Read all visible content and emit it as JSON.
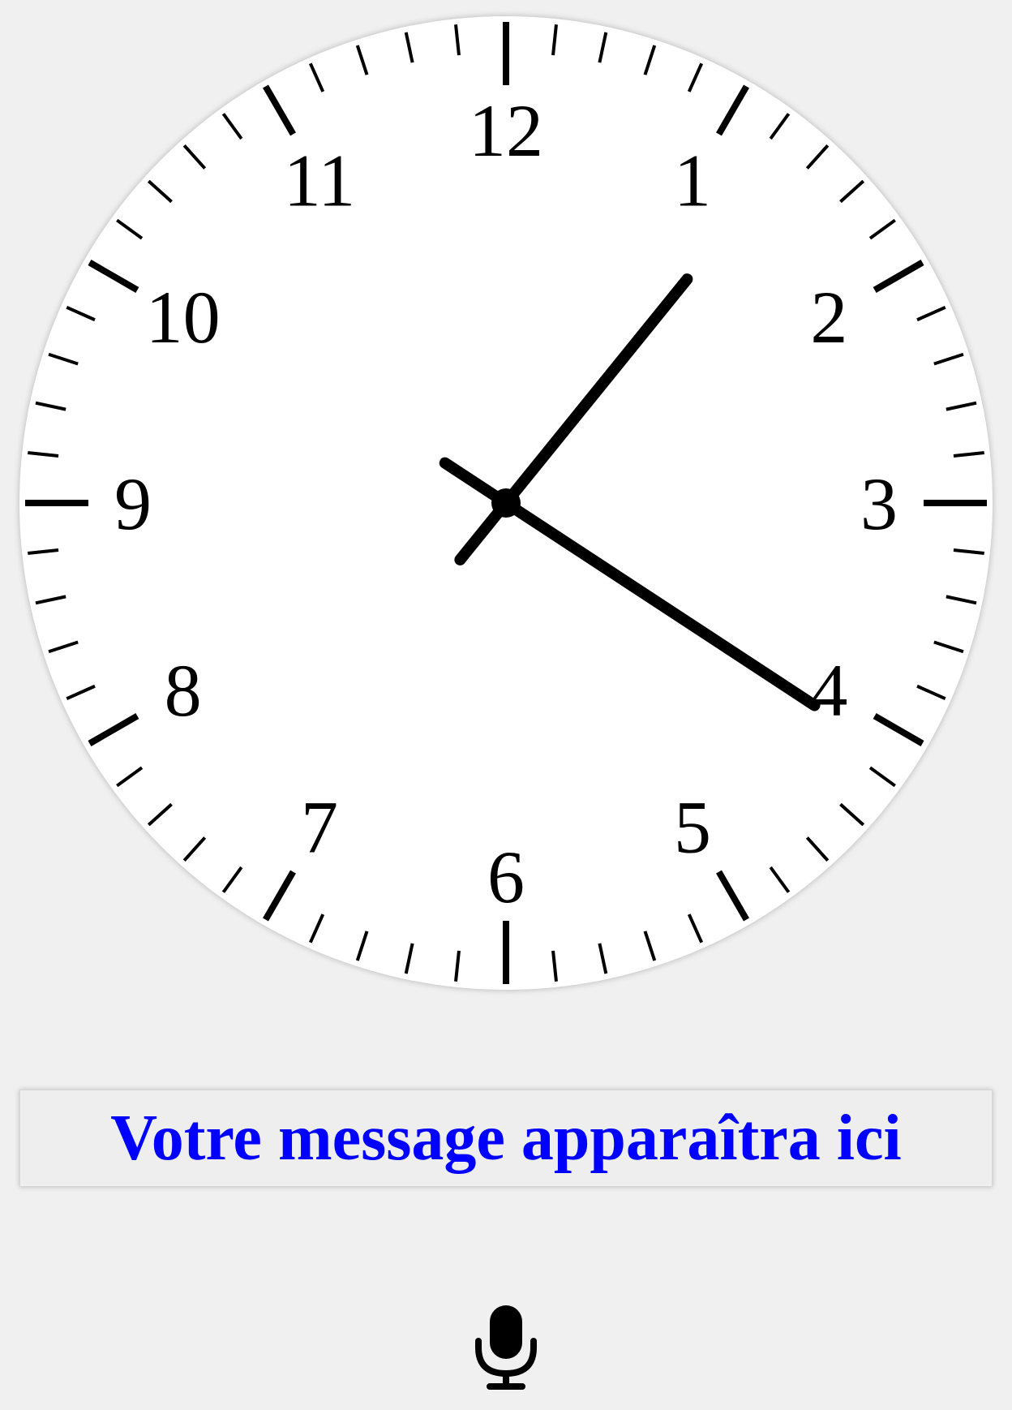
{
  "clock": {
    "numerals": [
      "12",
      "1",
      "2",
      "3",
      "4",
      "5",
      "6",
      "7",
      "8",
      "9",
      "10",
      "11"
    ],
    "time": {
      "hours": 4,
      "minutes": 6.5
    },
    "face_color": "#ffffff",
    "hand_color": "#000000"
  },
  "message": {
    "text": "Votre message apparaîtra ici",
    "color": "#0000ff"
  },
  "icons": {
    "mic": "microphone-icon"
  }
}
